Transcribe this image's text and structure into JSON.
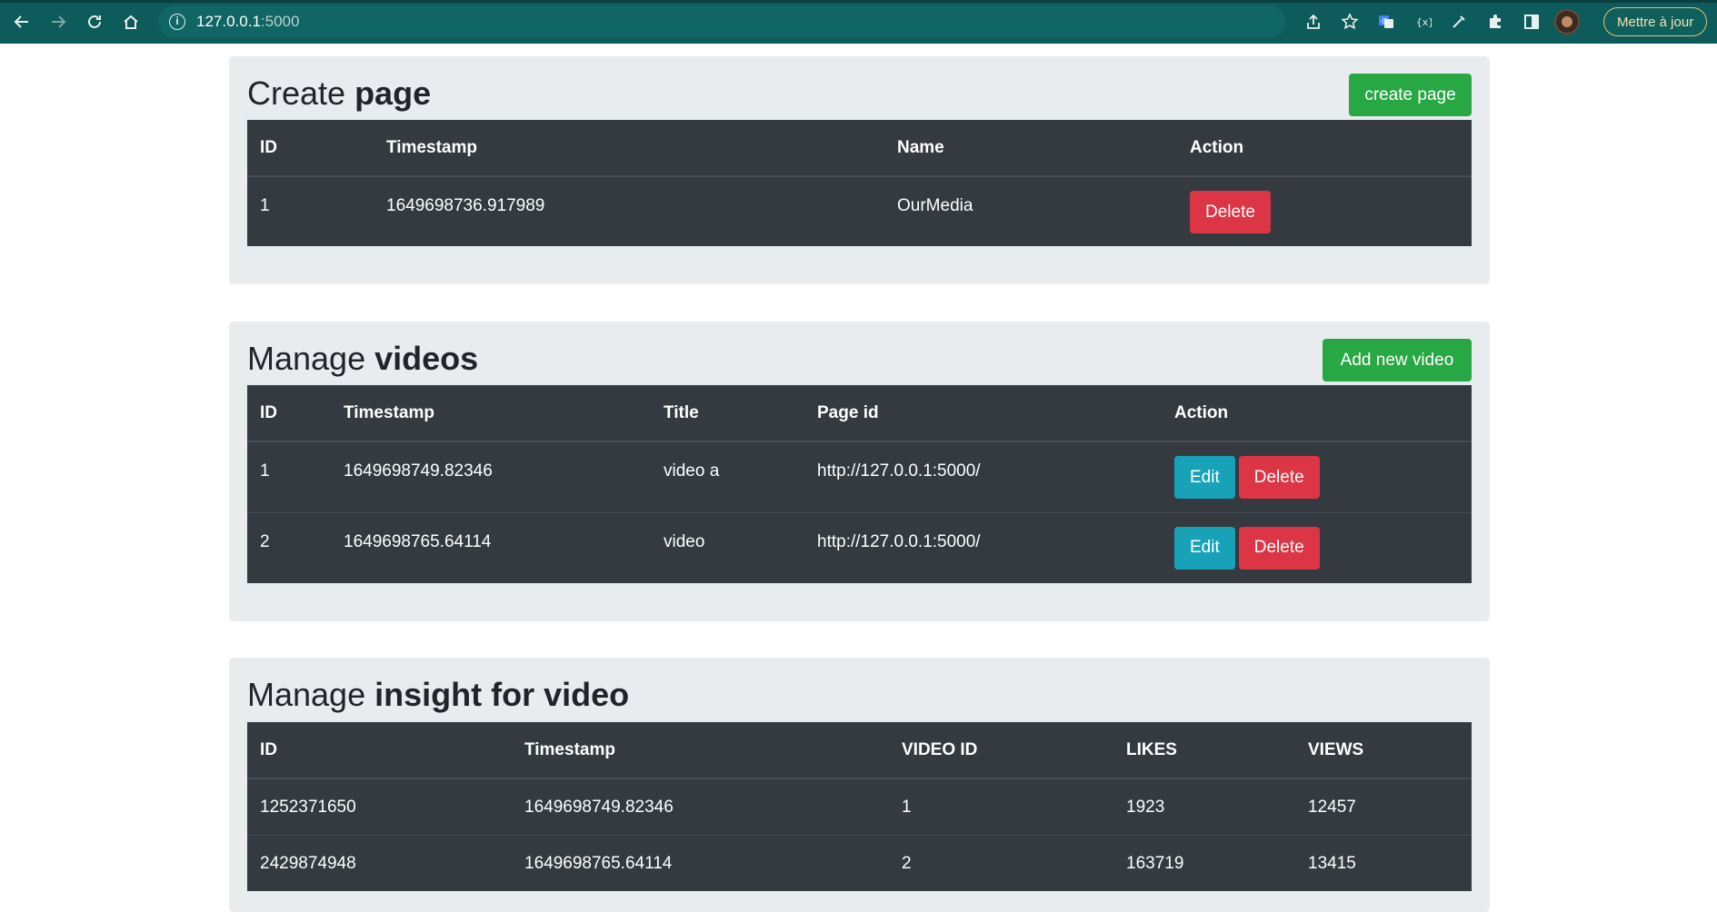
{
  "browser": {
    "url_host": "127.0.0.1",
    "url_port": ":5000",
    "update_label": "Mettre à jour"
  },
  "create_page": {
    "title_light": "Create ",
    "title_bold": "page",
    "action_label": "create page",
    "columns": [
      "ID",
      "Timestamp",
      "Name",
      "Action"
    ],
    "rows": [
      {
        "id": "1",
        "timestamp": "1649698736.917989",
        "name": "OurMedia",
        "delete_label": "Delete"
      }
    ]
  },
  "manage_videos": {
    "title_light": "Manage ",
    "title_bold": "videos",
    "action_label": "Add new video",
    "columns": [
      "ID",
      "Timestamp",
      "Title",
      "Page id",
      "Action"
    ],
    "rows": [
      {
        "id": "1",
        "timestamp": "1649698749.82346",
        "title": "video a",
        "page_id": "http://127.0.0.1:5000/",
        "edit_label": "Edit",
        "delete_label": "Delete"
      },
      {
        "id": "2",
        "timestamp": "1649698765.64114",
        "title": "video",
        "page_id": "http://127.0.0.1:5000/",
        "edit_label": "Edit",
        "delete_label": "Delete"
      }
    ]
  },
  "manage_insight": {
    "title_light": "Manage ",
    "title_bold": "insight for video",
    "columns": [
      "ID",
      "Timestamp",
      "VIDEO ID",
      "LIKES",
      "VIEWS"
    ],
    "rows": [
      {
        "id": "1252371650",
        "timestamp": "1649698749.82346",
        "video_id": "1",
        "likes": "1923",
        "views": "12457"
      },
      {
        "id": "2429874948",
        "timestamp": "1649698765.64114",
        "video_id": "2",
        "likes": "163719",
        "views": "13415"
      }
    ]
  },
  "colors": {
    "success": "#28a745",
    "danger": "#dc3545",
    "info": "#17a2b8",
    "table_dark": "#343a40",
    "panel_bg": "#e9ecef",
    "browser_toolbar": "#0d5b5a"
  }
}
